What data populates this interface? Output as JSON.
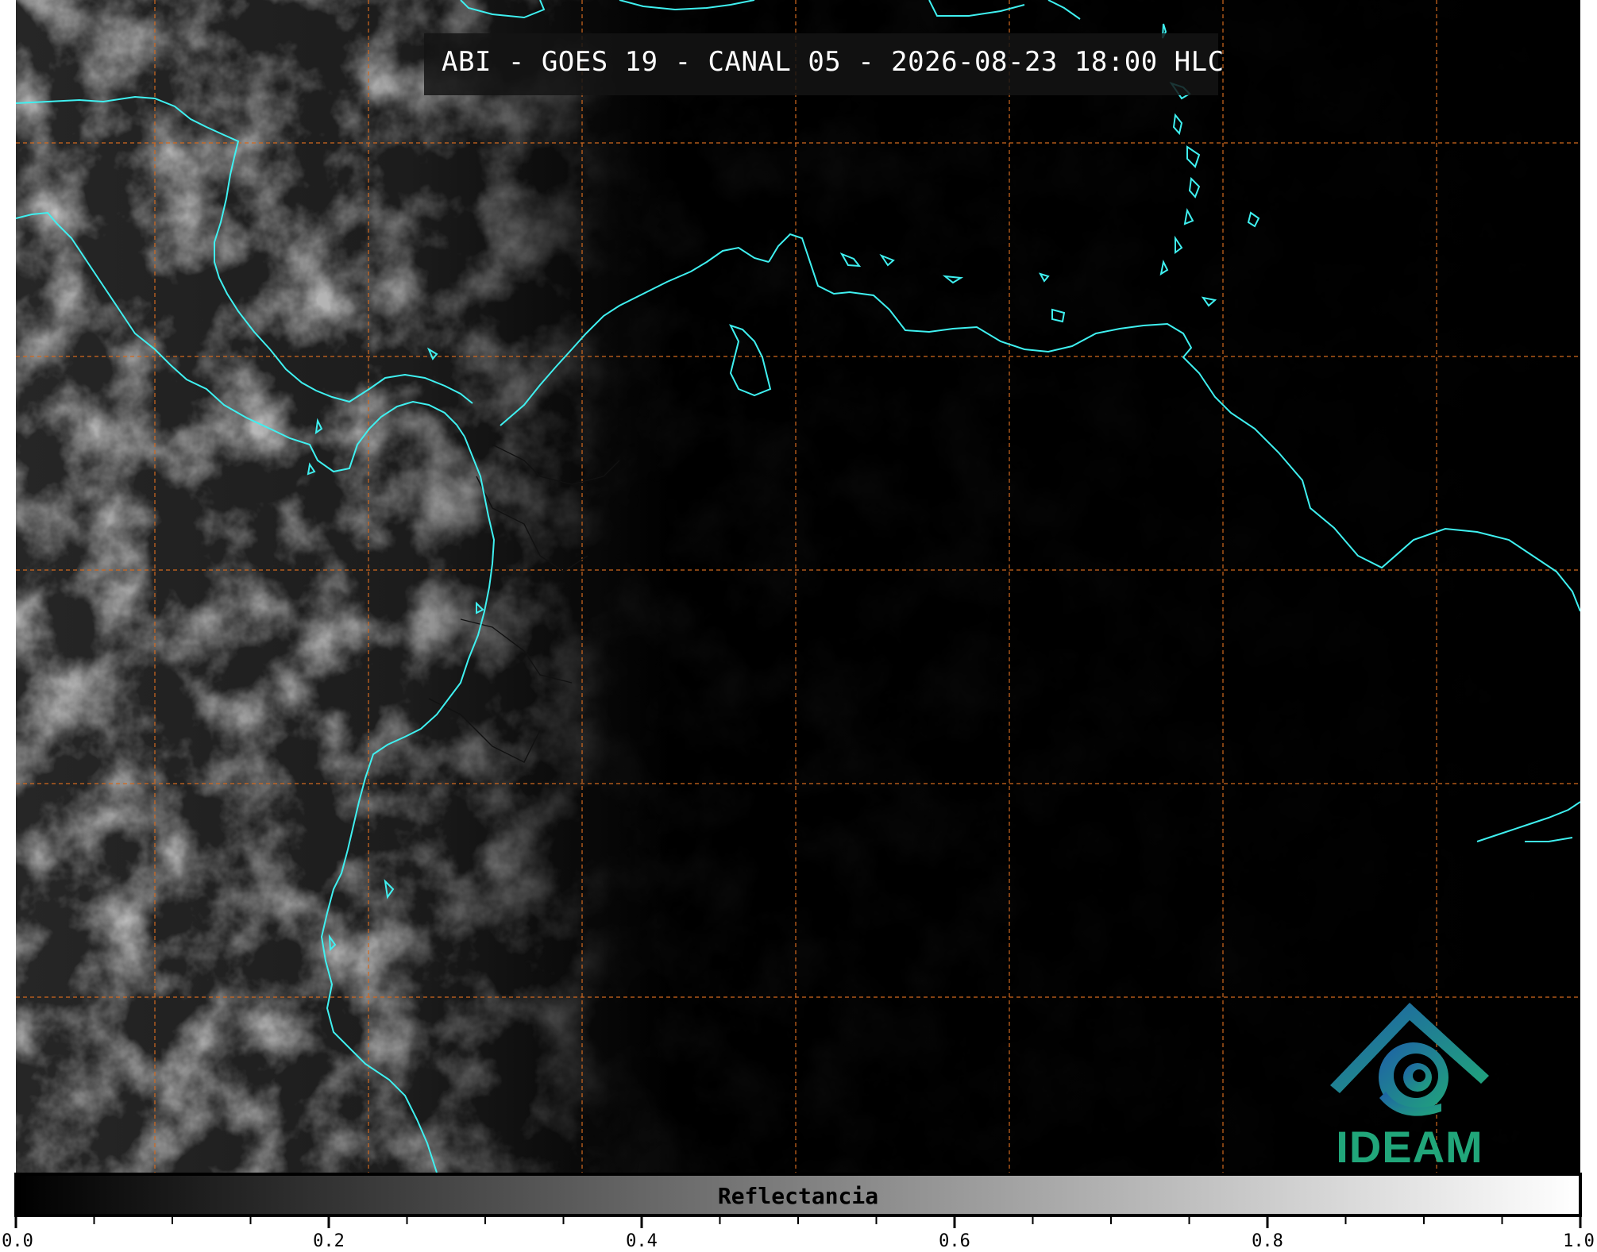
{
  "title": "ABI - GOES 19 - CANAL 05 - 2026-08-23 18:00 HLC",
  "logo": {
    "text": "IDEAM",
    "icon": "ideam-logo-icon",
    "color": "#21a67a"
  },
  "colorbar": {
    "label": "Reflectancia",
    "min": 0.0,
    "max": 1.0,
    "major_ticks": [
      {
        "value": 0.0,
        "label": "0.0"
      },
      {
        "value": 0.2,
        "label": "0.2"
      },
      {
        "value": 0.4,
        "label": "0.4"
      },
      {
        "value": 0.6,
        "label": "0.6"
      },
      {
        "value": 0.8,
        "label": "0.8"
      },
      {
        "value": 1.0,
        "label": "1.0"
      }
    ],
    "minor_tick_step": 0.05,
    "colormap": [
      "#000000",
      "#ffffff"
    ]
  },
  "map": {
    "coastline_color": "#3ff0f0",
    "gridline_color": "#d2691e",
    "gridline_style": "dashed",
    "background": "#000000"
  }
}
